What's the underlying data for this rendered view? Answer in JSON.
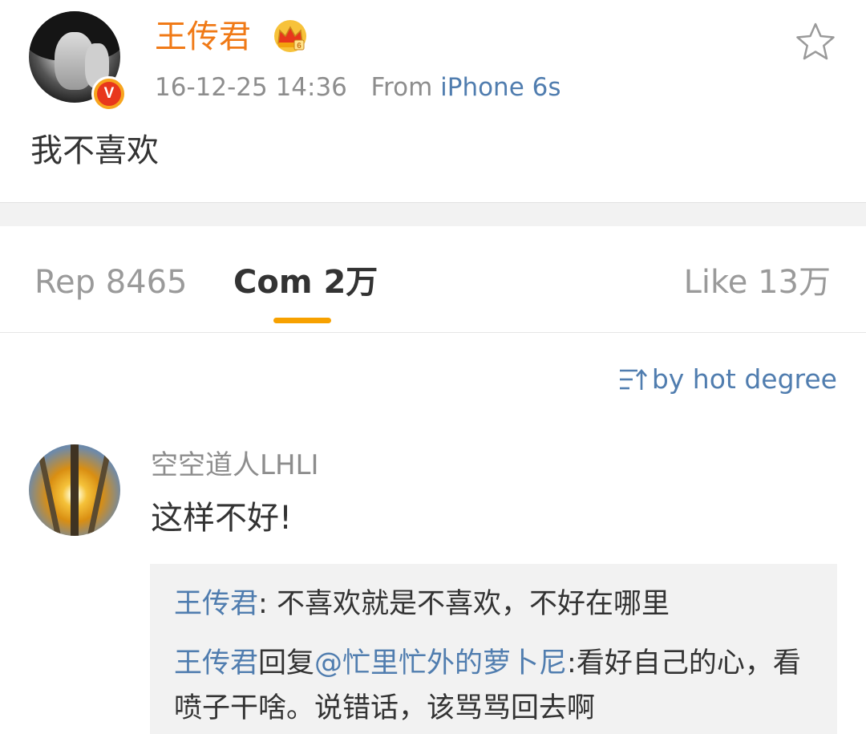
{
  "post": {
    "author": "王传君",
    "timestamp": "16-12-25 14:36",
    "source_prefix": "From",
    "source_device": "iPhone 6s",
    "text": "我不喜欢",
    "verified_badge": "V",
    "colors": {
      "author": "#f07a17",
      "link": "#507daf",
      "meta": "#8d8d8d"
    }
  },
  "tabs": [
    {
      "label": "Rep 8465"
    },
    {
      "label": "Com 2万"
    },
    {
      "label": "Like 13万"
    }
  ],
  "active_tab": "Com 2万",
  "sort": {
    "label": "by hot degree",
    "icon": "sort-icon"
  },
  "comment": {
    "author": "空空道人LHLI",
    "text": "这样不好!",
    "replies": [
      {
        "author": "王传君",
        "separator": ": ",
        "text": "不喜欢就是不喜欢，不好在哪里"
      },
      {
        "author": "王传君",
        "reply_word": "回复",
        "mention": "@忙里忙外的萝卜尼",
        "text": ":看好自己的心，看喷子干啥。说错话，该骂骂回去啊"
      }
    ]
  },
  "icons": [
    "crown-badge-icon",
    "star-icon",
    "verified-icon",
    "sort-icon"
  ]
}
